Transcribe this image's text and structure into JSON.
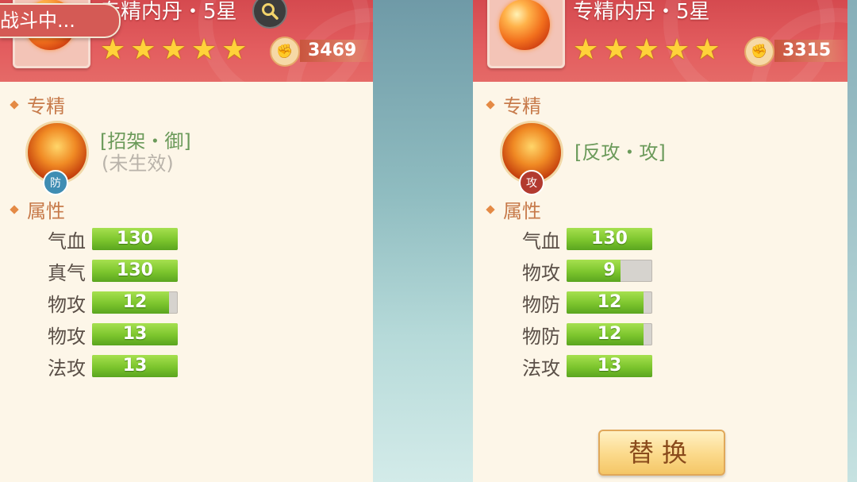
{
  "battle_tag": "战斗中...",
  "colors": {
    "header": "#d54a4f",
    "panel_bg": "#fdf6e8",
    "bar_fill": "#7cc52d",
    "skill_green": "#6b9a5a"
  },
  "left": {
    "item_name": "专精内丹・5星",
    "stars": 5,
    "score": "3469",
    "specialty_title": "专精",
    "skill_name": "[招架・御]",
    "skill_status": "(未生效)",
    "skill_badge": "防",
    "attributes_title": "属性",
    "attributes": [
      {
        "label": "气血",
        "value": "130",
        "fill": 1.0
      },
      {
        "label": "真气",
        "value": "130",
        "fill": 1.0
      },
      {
        "label": "物攻",
        "value": "12",
        "fill": 0.9
      },
      {
        "label": "物攻",
        "value": "13",
        "fill": 1.0
      },
      {
        "label": "法攻",
        "value": "13",
        "fill": 1.0
      }
    ]
  },
  "right": {
    "item_name": "专精内丹・5星",
    "stars": 5,
    "score": "3315",
    "specialty_title": "专精",
    "skill_name": "[反攻・攻]",
    "skill_badge": "攻",
    "attributes_title": "属性",
    "attributes": [
      {
        "label": "气血",
        "value": "130",
        "fill": 1.0
      },
      {
        "label": "物攻",
        "value": "9",
        "fill": 0.63
      },
      {
        "label": "物防",
        "value": "12",
        "fill": 0.9
      },
      {
        "label": "物防",
        "value": "12",
        "fill": 0.9
      },
      {
        "label": "法攻",
        "value": "13",
        "fill": 1.0
      }
    ],
    "replace_label": "替换"
  }
}
